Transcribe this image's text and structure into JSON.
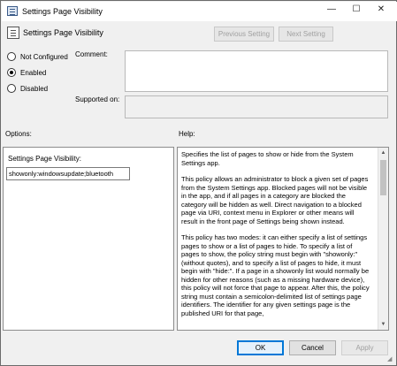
{
  "window": {
    "title": "Settings Page Visibility",
    "minimize_glyph": "—",
    "maximize_glyph": "☐",
    "close_glyph": "✕"
  },
  "header": {
    "title": "Settings Page Visibility",
    "previous_label": "Previous Setting",
    "next_label": "Next Setting"
  },
  "state": {
    "options": [
      {
        "label": "Not Configured",
        "selected": false
      },
      {
        "label": "Enabled",
        "selected": true
      },
      {
        "label": "Disabled",
        "selected": false
      }
    ]
  },
  "comment": {
    "label": "Comment:",
    "value": ""
  },
  "supported": {
    "label": "Supported on:",
    "value": ""
  },
  "options_section": {
    "label": "Options:",
    "field_label": "Settings Page Visibility:",
    "field_value": "showonly:windowsupdate;bluetooth"
  },
  "help_section": {
    "label": "Help:",
    "paragraphs": [
      "Specifies the list of pages to show or hide from the System Settings app.",
      "This policy allows an administrator to block a given set of pages from the System Settings app. Blocked pages will not be visible in the app, and if all pages in a category are blocked the category will be hidden as well. Direct navigation to a blocked page via URI, context menu in Explorer or other means will result in the front page of Settings being shown instead.",
      "This policy has two modes: it can either specify a list of settings pages to show or a list of pages to hide. To specify a list of pages to show, the policy string must begin with \"showonly:\" (without quotes), and to specify a list of pages to hide, it must begin with \"hide:\". If a page in a showonly list would normally be hidden for other reasons (such as a missing hardware device), this policy will not force that page to appear. After this, the policy string must contain a semicolon-delimited list of settings page identifiers. The identifier for any given settings page is the published URI for that page,"
    ]
  },
  "footer": {
    "ok_label": "OK",
    "cancel_label": "Cancel",
    "apply_label": "Apply"
  },
  "colors": {
    "ok_border": "#0078d7",
    "dialog_bg": "#f0f0f0",
    "disabled_text": "#a0a0a0"
  }
}
